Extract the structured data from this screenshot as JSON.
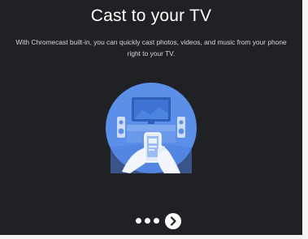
{
  "screen": {
    "title": "Cast to your TV",
    "description": "With Chromecast built-in, you can quickly cast photos, videos, and music from your phone right to your TV."
  },
  "illustration": {
    "icon": "cast-to-tv-illustration",
    "colors": {
      "circle": "#5b8fe8",
      "tv_screen": "#3b6fcf",
      "hand": "#ffffff"
    }
  },
  "pager": {
    "page_count": 4,
    "current_page": 4,
    "next_icon": "chevron-right-icon"
  },
  "colors": {
    "background": "#202124",
    "text": "#ffffff",
    "accent": "#5b8fe8"
  }
}
